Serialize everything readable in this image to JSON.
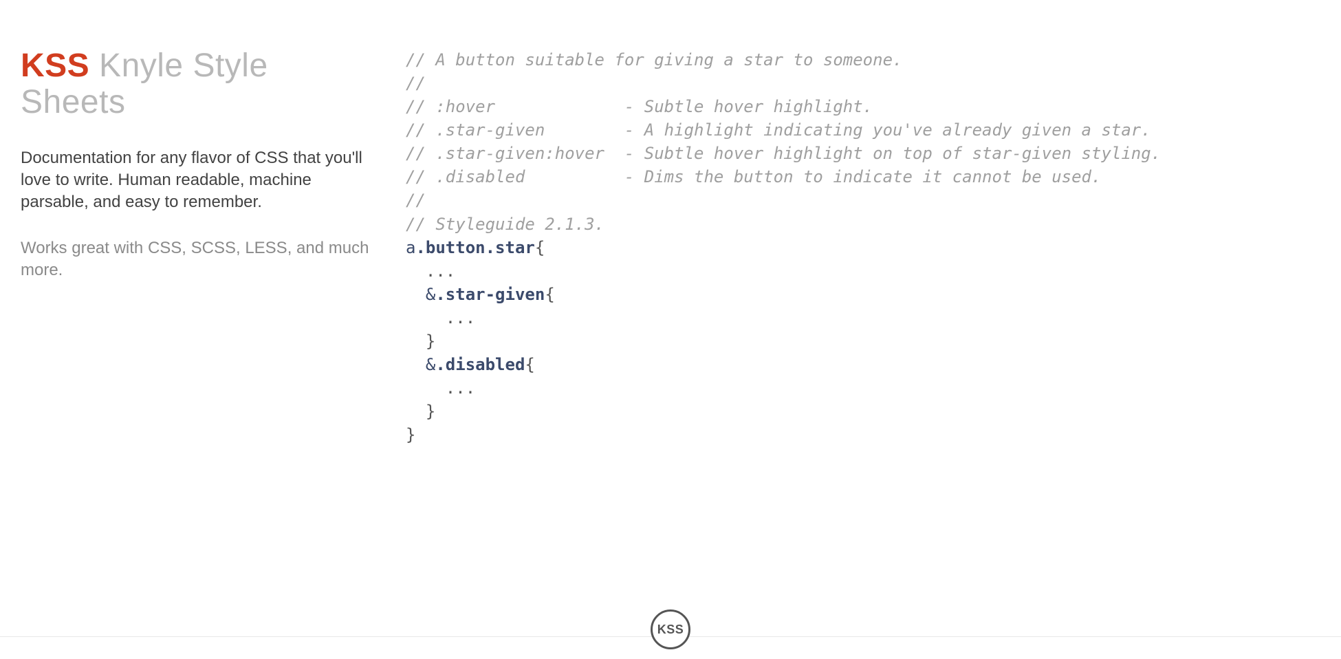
{
  "header": {
    "brand": "KSS",
    "subtitle": "Knyle Style Sheets"
  },
  "intro": "Documentation for any flavor of CSS that you'll love to write. Human readable, machine parsable, and easy to remember.",
  "subnote": "Works great with CSS, SCSS, LESS, and much more.",
  "code": {
    "c1": "// A button suitable for giving a star to someone.",
    "c2": "//",
    "c3": "// :hover             - Subtle hover highlight.",
    "c4": "// .star-given        - A highlight indicating you've already given a star.",
    "c5": "// .star-given:hover  - Subtle hover highlight on top of star-given styling.",
    "c6": "// .disabled          - Dims the button to indicate it cannot be used.",
    "c7": "//",
    "c8": "// Styleguide 2.1.3.",
    "sel_a": "a",
    "sel_button": ".button",
    "sel_star": ".star",
    "brace_open": "{",
    "brace_close": "}",
    "ellipsis": "...",
    "amp": "&",
    "sel_stargiven": ".star-given",
    "sel_disabled": ".disabled"
  },
  "badge": "KSS"
}
